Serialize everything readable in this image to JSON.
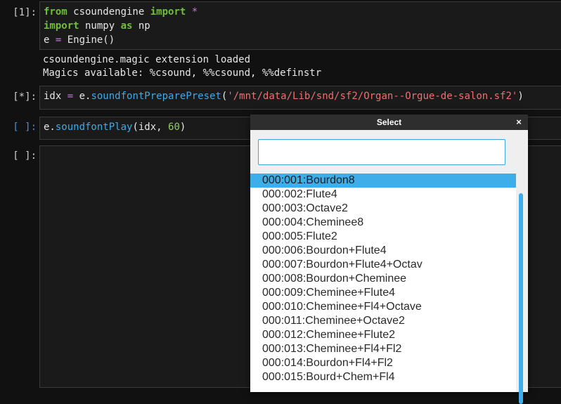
{
  "cells": [
    {
      "prompt": "[1]:",
      "code": [
        [
          {
            "t": "from",
            "c": "kw"
          },
          {
            "t": " csoundengine ",
            "c": "plain"
          },
          {
            "t": "import",
            "c": "kw"
          },
          {
            "t": " ",
            "c": "plain"
          },
          {
            "t": "*",
            "c": "op"
          }
        ],
        [
          {
            "t": "import",
            "c": "kw"
          },
          {
            "t": " numpy ",
            "c": "plain"
          },
          {
            "t": "as",
            "c": "kw"
          },
          {
            "t": " np",
            "c": "plain"
          }
        ],
        [
          {
            "t": "e ",
            "c": "plain"
          },
          {
            "t": "=",
            "c": "op"
          },
          {
            "t": " Engine()",
            "c": "plain"
          }
        ]
      ],
      "output": [
        "csoundengine.magic extension loaded",
        "Magics available: %csound, %%csound, %%definstr"
      ]
    },
    {
      "prompt": "[*]:",
      "code": [
        [
          {
            "t": "idx ",
            "c": "plain"
          },
          {
            "t": "=",
            "c": "op"
          },
          {
            "t": " e.",
            "c": "plain"
          },
          {
            "t": "soundfontPreparePreset",
            "c": "fn"
          },
          {
            "t": "(",
            "c": "plain"
          },
          {
            "t": "'/mnt/data/Lib/snd/sf2/Organ--Orgue-de-salon.sf2'",
            "c": "str"
          },
          {
            "t": ")",
            "c": "plain"
          }
        ]
      ]
    },
    {
      "prompt": "[ ]:",
      "code": [
        [
          {
            "t": "e.",
            "c": "plain"
          },
          {
            "t": "soundfontPlay",
            "c": "fn"
          },
          {
            "t": "(idx, ",
            "c": "plain"
          },
          {
            "t": "60",
            "c": "num"
          },
          {
            "t": ")",
            "c": "plain"
          }
        ]
      ]
    },
    {
      "prompt": "[ ]:",
      "code": []
    }
  ],
  "dialog": {
    "title": "Select",
    "close_glyph": "×",
    "search_value": "",
    "items": [
      "000:001:Bourdon8",
      "000:002:Flute4",
      "000:003:Octave2",
      "000:004:Cheminee8",
      "000:005:Flute2",
      "000:006:Bourdon+Flute4",
      "000:007:Bourdon+Flute4+Octav",
      "000:008:Bourdon+Cheminee",
      "000:009:Cheminee+Flute4",
      "000:010:Cheminee+Fl4+Octave",
      "000:011:Cheminee+Octave2",
      "000:012:Cheminee+Flute2",
      "000:013:Cheminee+Fl4+Fl2",
      "000:014:Bourdon+Fl4+Fl2",
      "000:015:Bourd+Chem+Fl4"
    ],
    "selected_index": 0
  }
}
